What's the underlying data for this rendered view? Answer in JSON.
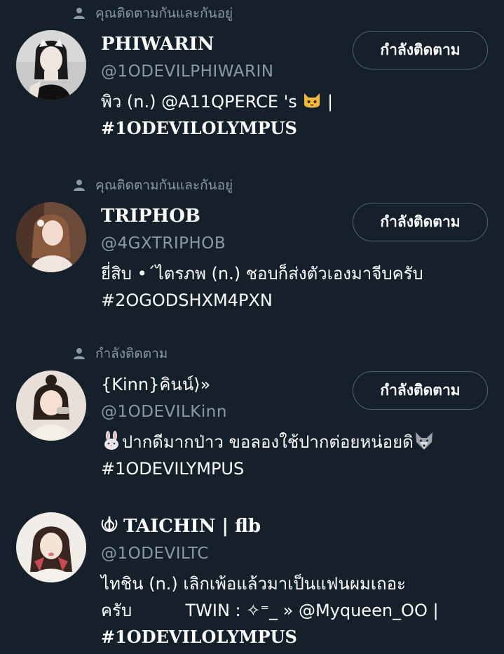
{
  "colors": {
    "background": "#15202b",
    "secondary_text": "#8b98a5",
    "primary_text": "#ffffff",
    "button_border": "#536471"
  },
  "users": [
    {
      "context_icon": "person-icon",
      "context": "คุณติดตามกันและกันอยู่",
      "name": "PHIWARIN",
      "handle": "@1ODEVILPHIWARIN",
      "button": "กำลังติดตาม",
      "bio_line1_a": "พิว (n.)  @A11QPERCE 's ",
      "bio_line1_emoji": "cat-face-emoji",
      "bio_line1_b": " |",
      "bio_line2": "#1ODEVILOLYMPUS"
    },
    {
      "context_icon": "person-icon",
      "context": "คุณติดตามกันและกันอยู่",
      "name": "TRIPHOB",
      "handle": "@4GXTRIPHOB",
      "button": "กำลังติดตาม",
      "bio_line1": "ยี่สิบ •ˊไตรภพ (n.) ชอบก็ส่งตัวเองมาจีบครับ",
      "bio_line2": "#2OGODSHXM4PXN"
    },
    {
      "context_icon": "person-icon",
      "context": "กำลังติดตาม",
      "name": "{Kinn}คินน์⟩»",
      "handle": "@1ODEVILKinn",
      "button": "กำลังติดตาม",
      "bio_line1_emoji_a": "rabbit-face-emoji",
      "bio_line1": "ปากดีมากป่าว ขอลองใช้ปากต่อยหน่อยดิ",
      "bio_line1_emoji_b": "wolf-face-emoji",
      "bio_line2": "#1ODEVILYMPUS"
    },
    {
      "name_emoji": "khanda-emoji",
      "name": "TAICHIN | flb",
      "handle": "@1ODEVILTC",
      "bio_line1": "ไทชิน (n.) เลิกเพ้อแล้วมาเป็นแฟนผมเถอะ",
      "bio_line2": "ครับ          TWIN : ✧⁼_ » @Myqueen_OO |",
      "bio_line3": "#1ODEVILOLYMPUS"
    }
  ]
}
